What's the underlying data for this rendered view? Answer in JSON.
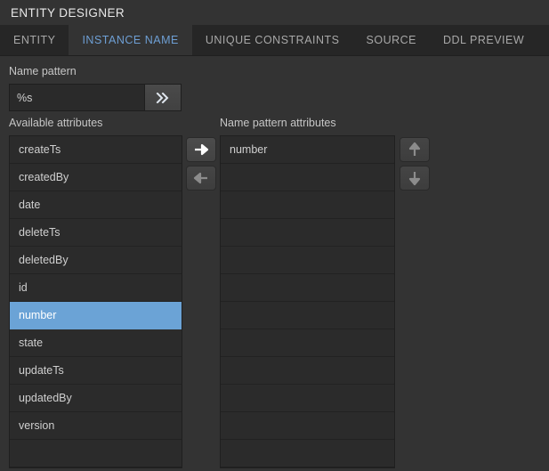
{
  "header": {
    "title": "ENTITY DESIGNER"
  },
  "tabs": [
    {
      "label": "ENTITY",
      "active": false
    },
    {
      "label": "INSTANCE NAME",
      "active": true
    },
    {
      "label": "UNIQUE CONSTRAINTS",
      "active": false
    },
    {
      "label": "SOURCE",
      "active": false
    },
    {
      "label": "DDL PREVIEW",
      "active": false
    }
  ],
  "name_pattern": {
    "label": "Name pattern",
    "value": "%s",
    "placeholder": "",
    "expand_button_icon": "double-chevron-right-icon"
  },
  "available_attributes": {
    "label": "Available attributes",
    "items": [
      {
        "label": "createTs",
        "selected": false
      },
      {
        "label": "createdBy",
        "selected": false
      },
      {
        "label": "date",
        "selected": false
      },
      {
        "label": "deleteTs",
        "selected": false
      },
      {
        "label": "deletedBy",
        "selected": false
      },
      {
        "label": "id",
        "selected": false
      },
      {
        "label": "number",
        "selected": true
      },
      {
        "label": "state",
        "selected": false
      },
      {
        "label": "updateTs",
        "selected": false
      },
      {
        "label": "updatedBy",
        "selected": false
      },
      {
        "label": "version",
        "selected": false
      }
    ]
  },
  "name_pattern_attributes": {
    "label": "Name pattern attributes",
    "items": [
      {
        "label": "number",
        "selected": false
      }
    ]
  },
  "buttons": {
    "move_right": "arrow-right-icon",
    "move_left": "arrow-left-icon",
    "move_up": "arrow-up-icon",
    "move_down": "arrow-down-icon"
  },
  "colors": {
    "background": "#333333",
    "tabbar": "#262626",
    "panel": "#2b2b2b",
    "accent": "#6ba3d6",
    "active_tab_text": "#6e9fd4"
  }
}
